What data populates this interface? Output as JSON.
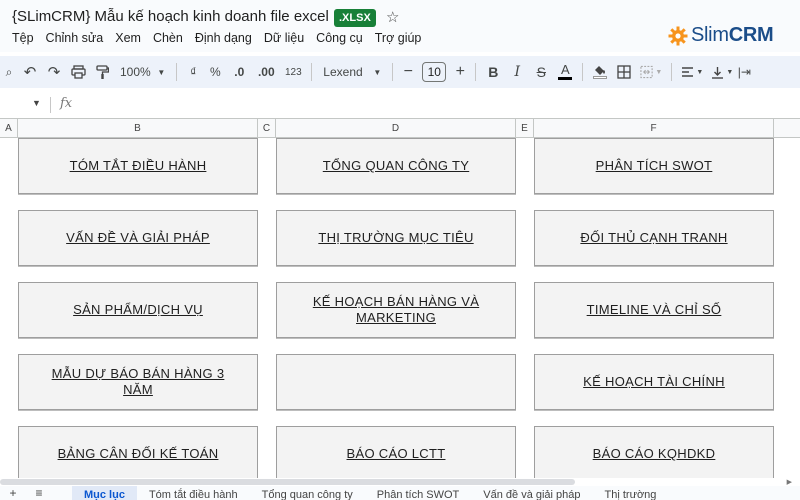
{
  "title": {
    "document_name": "{SLimCRM} Mẫu kế hoạch kinh doanh file excel",
    "file_badge": ".XLSX"
  },
  "menu": [
    "Tệp",
    "Chỉnh sửa",
    "Xem",
    "Chèn",
    "Định dạng",
    "Dữ liệu",
    "Công cụ",
    "Trợ giúp"
  ],
  "brand": {
    "prefix": "Slim",
    "suffix": "CRM",
    "color": "#1b4d89",
    "gear_color": "#f7941d"
  },
  "toolbar": {
    "zoom": "100%",
    "currency": "₫",
    "percent": "%",
    "decrease_decimal": ".0",
    "increase_decimal": ".00",
    "number_format": "123",
    "font": "Lexend",
    "font_size": "10"
  },
  "columns": [
    "A",
    "B",
    "C",
    "D",
    "E",
    "F"
  ],
  "cards": [
    [
      "TÓM TẮT ĐIỀU HÀNH",
      "TỔNG QUAN CÔNG TY",
      "PHÂN TÍCH SWOT"
    ],
    [
      "VẤN ĐỀ VÀ GIẢI PHÁP",
      "THỊ TRƯỜNG MỤC TIÊU",
      "ĐỐI THỦ CẠNH TRANH"
    ],
    [
      "SẢN PHẨM/DỊCH VỤ",
      "KẾ HOẠCH BÁN HÀNG VÀ MARKETING",
      "TIMELINE VÀ CHỈ SỐ"
    ],
    [
      "MẪU DỰ BÁO BÁN HÀNG 3 NĂM",
      "",
      "KẾ HOẠCH TÀI CHÍNH"
    ],
    [
      "BẢNG CÂN ĐỐI KẾ TOÁN",
      "BÁO CÁO LCTT",
      "BÁO CÁO KQHDKD"
    ]
  ],
  "sheet_tabs": [
    "Mục lục",
    "Tóm tắt điều hành",
    "Tổng quan công ty",
    "Phân tích SWOT",
    "Vấn đề và giải pháp",
    "Thị trường"
  ],
  "accent_colors": {
    "xlsx_badge": "#188038",
    "toolbar_bg": "#edf2fa",
    "card_bg": "#f3f3f3"
  }
}
